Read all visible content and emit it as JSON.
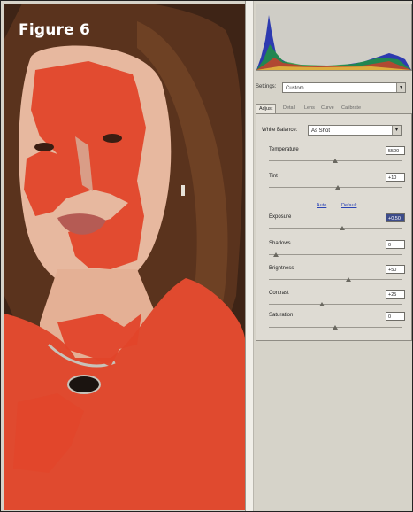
{
  "figure_label": "Figure 6",
  "settings": {
    "label": "Settings:",
    "value": "Custom"
  },
  "tabs": [
    {
      "label": "Adjust",
      "active": true
    },
    {
      "label": "Detail",
      "active": false
    },
    {
      "label": "Lens",
      "active": false
    },
    {
      "label": "Curve",
      "active": false
    },
    {
      "label": "Calibrate",
      "active": false
    }
  ],
  "white_balance": {
    "label": "White Balance:",
    "value": "As Shot"
  },
  "temperature": {
    "label": "Temperature",
    "value": "5500",
    "level": 0.5
  },
  "tint": {
    "label": "Tint",
    "value": "+10",
    "level": 0.52
  },
  "links": {
    "auto": "Auto",
    "default": "Default"
  },
  "exposure": {
    "label": "Exposure",
    "value": "+0.50",
    "level": 0.55
  },
  "shadows": {
    "label": "Shadows",
    "value": "0",
    "level": 0.05
  },
  "brightness": {
    "label": "Brightness",
    "value": "+50",
    "level": 0.6
  },
  "contrast": {
    "label": "Contrast",
    "value": "+25",
    "level": 0.4
  },
  "saturation": {
    "label": "Saturation",
    "value": "0",
    "level": 0.5
  },
  "colors": {
    "overlay": "#e2452a",
    "selection": "#3d4c8a"
  }
}
